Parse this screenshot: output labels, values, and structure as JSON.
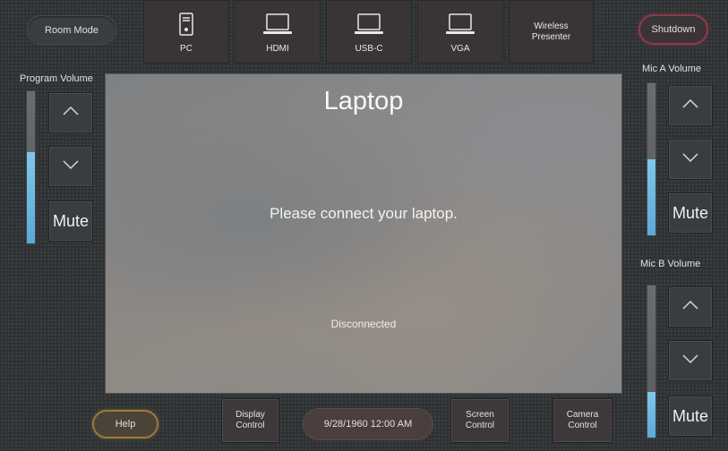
{
  "header": {
    "room_mode": "Room Mode",
    "shutdown": "Shutdown"
  },
  "sources": [
    {
      "label": "PC",
      "icon": "pc-tower-icon"
    },
    {
      "label": "HDMI",
      "icon": "laptop-icon"
    },
    {
      "label": "USB-C",
      "icon": "laptop-icon"
    },
    {
      "label": "VGA",
      "icon": "laptop-icon"
    },
    {
      "label": "Wireless\nPresenter",
      "icon": ""
    }
  ],
  "program_volume": {
    "label": "Program Volume",
    "level": 0.6,
    "mute": "Mute"
  },
  "mic_a_volume": {
    "label": "Mic A Volume",
    "level": 0.5,
    "mute": "Mute"
  },
  "mic_b_volume": {
    "label": "Mic B Volume",
    "level": 0.3,
    "mute": "Mute"
  },
  "content": {
    "title": "Laptop",
    "message": "Please connect your laptop.",
    "status": "Disconnected"
  },
  "footer": {
    "help": "Help",
    "display_control": "Display\nControl",
    "datetime": "9/28/1960 12:00 AM",
    "screen_control": "Screen\nControl",
    "camera_control": "Camera\nControl"
  },
  "colors": {
    "volume_fill": "#6bb8e2",
    "shutdown_border": "#8e3a4a",
    "help_border": "#9a7a3c"
  }
}
